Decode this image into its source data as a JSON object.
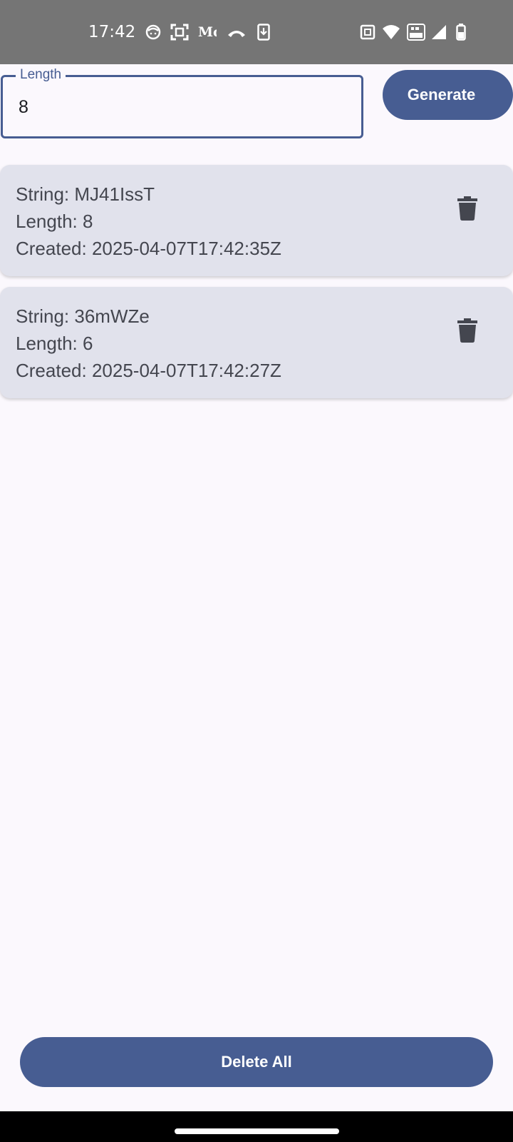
{
  "status_bar": {
    "time": "17:42",
    "text_icon": "Mc",
    "icons": [
      "face-icon",
      "scan-icon",
      "text-notification-icon",
      "missed-call-icon",
      "download-icon",
      "nfc-icon",
      "wifi-icon",
      "vowifi-icon",
      "signal-icon",
      "battery-icon"
    ]
  },
  "length_field": {
    "label": "Length",
    "value": "8"
  },
  "generate_button": {
    "label": "Generate"
  },
  "items": [
    {
      "string": "String: MJ41IssT",
      "length": "Length: 8",
      "created": "Created: 2025-04-07T17:42:35Z",
      "icon": "delete-icon"
    },
    {
      "string": "String: 36mWZe",
      "length": "Length: 6",
      "created": "Created: 2025-04-07T17:42:27Z",
      "icon": "delete-icon"
    }
  ],
  "delete_all_button": {
    "label": "Delete All"
  },
  "colors": {
    "primary": "#475d92",
    "background": "#fbf8fd",
    "card": "#e1e2ec",
    "card_text": "#44464f",
    "status_bar": "#757575"
  }
}
